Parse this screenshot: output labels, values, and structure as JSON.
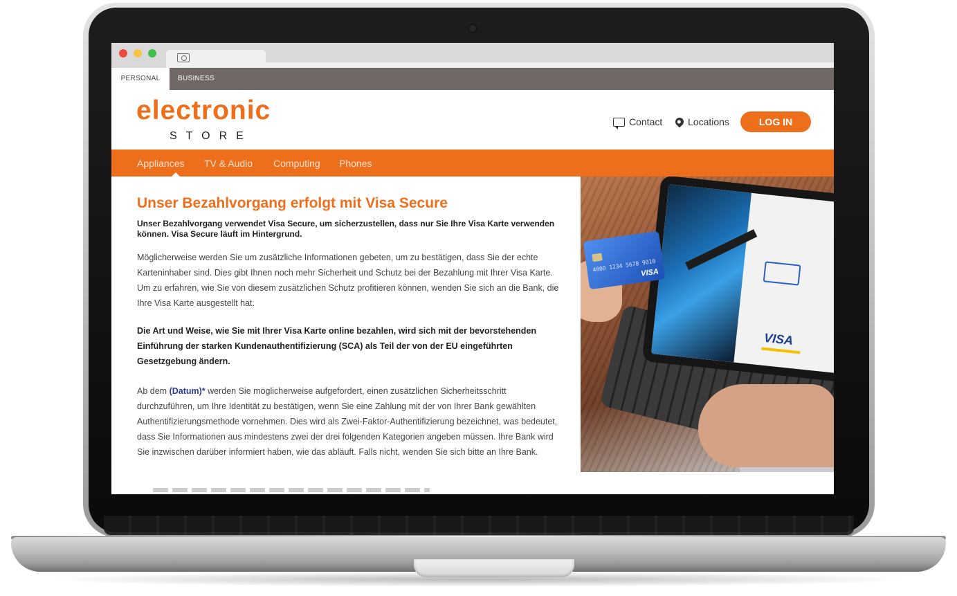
{
  "browser": {
    "tab_icon": "photo-icon"
  },
  "segments": {
    "personal": "PERSONAL",
    "business": "BUSINESS"
  },
  "logo": {
    "main": "electronic",
    "sub": "STORE"
  },
  "header_links": {
    "contact": "Contact",
    "locations": "Locations",
    "login": "LOG IN"
  },
  "nav": {
    "items": [
      "Appliances",
      "TV & Audio",
      "Computing",
      "Phones"
    ],
    "active": "Appliances"
  },
  "article": {
    "title": "Unser Bezahlvorgang erfolgt mit Visa Secure",
    "lead": "Unser Bezahlvorgang verwendet Visa Secure, um sicherzustellen, dass nur Sie Ihre Visa Karte verwenden können. Visa Secure läuft im Hintergrund.",
    "p1": "Möglicherweise werden Sie um zusätzliche Informationen gebeten, um zu bestätigen, dass Sie der echte Karteninhaber sind. Dies gibt Ihnen noch mehr Sicherheit und Schutz bei der Bezahlung mit Ihrer Visa Karte. Um zu erfahren, wie Sie von diesem zusätzlichen Schutz profitieren können, wenden Sie sich an die Bank, die Ihre Visa Karte ausgestellt hat.",
    "p2": "Die Art und Weise, wie Sie mit Ihrer Visa Karte online bezahlen, wird sich mit der bevorstehenden Einführung der starken Kundenauthentifizierung (SCA) als Teil der von der EU eingeführten Gesetzgebung ändern.",
    "p3_prefix": "Ab dem ",
    "p3_highlight": "(Datum)*",
    "p3_rest": " werden Sie möglicherweise aufgefordert, einen zusätzlichen Sicherheitsschritt durchzuführen, um Ihre Identität zu bestätigen, wenn Sie eine Zahlung mit der von Ihrer Bank gewählten Authentifizierungsmethode vornehmen. Dies wird als Zwei-Faktor-Authentifizierung bezeichnet, was bedeutet, dass Sie Informationen aus mindestens zwei der drei folgenden Kategorien angeben müssen. Ihre Bank wird Sie inzwischen darüber informiert haben, wie das abläuft. Falls nicht, wenden Sie sich bitte an Ihre Bank."
  },
  "hero_photo": {
    "card_number": "4000 1234 5678 9010",
    "card_brand": "VISA",
    "tablet_brand": "VISA"
  },
  "colors": {
    "accent": "#ee6f1b",
    "topbar": "#706866",
    "link_highlight": "#2a3e9a"
  }
}
